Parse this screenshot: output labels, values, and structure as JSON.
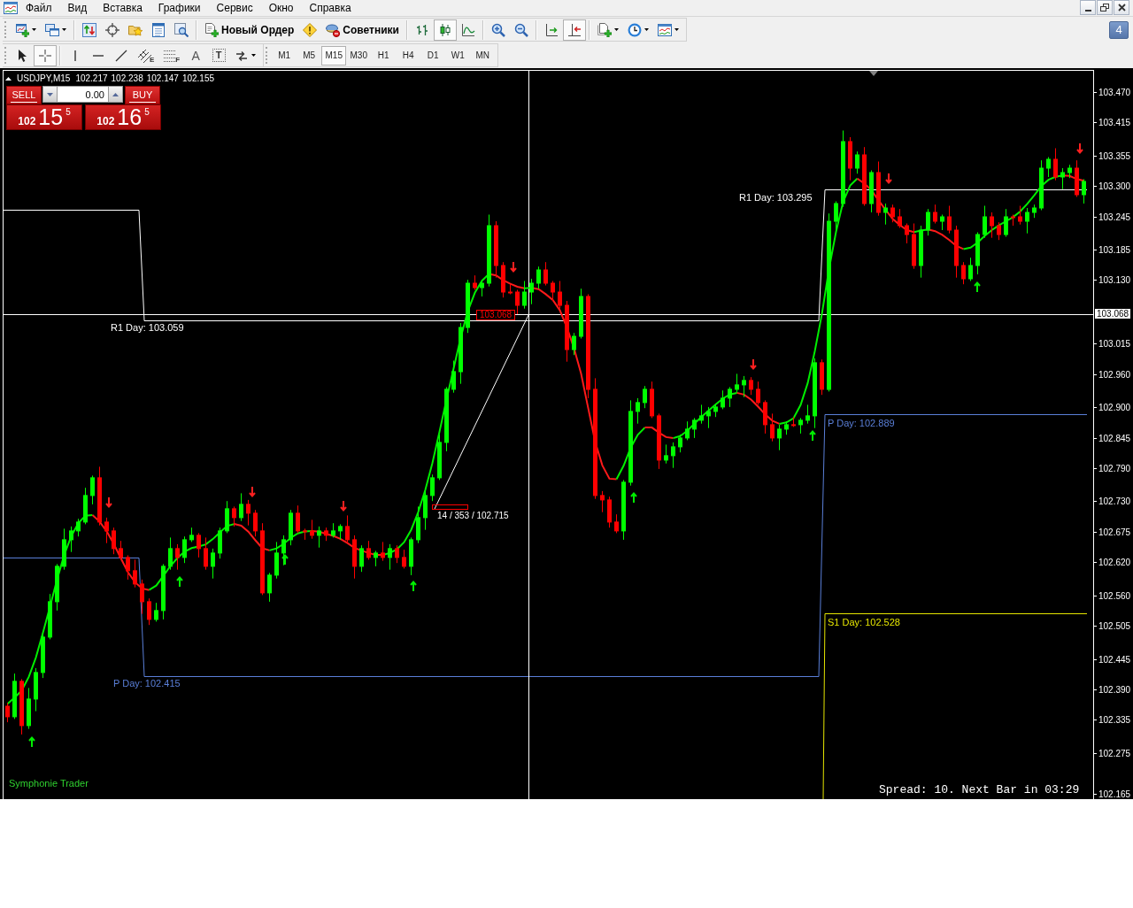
{
  "menu": {
    "items": [
      "Файл",
      "Вид",
      "Вставка",
      "Графики",
      "Сервис",
      "Окно",
      "Справка"
    ]
  },
  "toolbar": {
    "groups": [
      [
        {
          "kind": "newchart",
          "dropdown": true
        },
        {
          "kind": "profiles",
          "dropdown": true
        }
      ],
      [
        {
          "kind": "marketwatch"
        },
        {
          "kind": "navigator"
        },
        {
          "kind": "favorites"
        },
        {
          "kind": "terminal"
        },
        {
          "kind": "tester"
        }
      ],
      [
        {
          "kind": "neworder",
          "label": "Новый Ордер"
        },
        {
          "kind": "autotrading"
        },
        {
          "kind": "experts",
          "label": "Советники"
        }
      ],
      [
        {
          "kind": "bars",
          "selected": false
        },
        {
          "kind": "candles",
          "selected": true
        },
        {
          "kind": "line",
          "selected": false
        }
      ],
      [
        {
          "kind": "zoomin"
        },
        {
          "kind": "zoomout"
        }
      ],
      [
        {
          "kind": "shift",
          "selected": false
        },
        {
          "kind": "autoscroll",
          "selected": true
        }
      ],
      [
        {
          "kind": "template",
          "dropdown": true
        },
        {
          "kind": "periods",
          "dropdown": true
        },
        {
          "kind": "indicators",
          "dropdown": true
        }
      ]
    ],
    "messages": "4"
  },
  "drawing_toolbar": {
    "groups": [
      [
        {
          "kind": "cursor",
          "selected": false
        },
        {
          "kind": "crosshair",
          "selected": true
        }
      ],
      [
        {
          "kind": "vline"
        },
        {
          "kind": "hline"
        },
        {
          "kind": "trendline"
        },
        {
          "kind": "channel",
          "glyph": "E"
        },
        {
          "kind": "fibo",
          "glyph": "F"
        },
        {
          "kind": "text",
          "glyph": "A"
        },
        {
          "kind": "label",
          "glyph": "T"
        },
        {
          "kind": "arrows",
          "dropdown": true
        }
      ]
    ]
  },
  "timeframes": [
    {
      "label": "M1",
      "selected": false
    },
    {
      "label": "M5",
      "selected": false
    },
    {
      "label": "M15",
      "selected": true
    },
    {
      "label": "M30",
      "selected": false
    },
    {
      "label": "H1",
      "selected": false
    },
    {
      "label": "H4",
      "selected": false
    },
    {
      "label": "D1",
      "selected": false
    },
    {
      "label": "W1",
      "selected": false
    },
    {
      "label": "MN",
      "selected": false
    }
  ],
  "chart": {
    "symbol": "USDJPY,M15",
    "quotes": [
      "102.217",
      "102.238",
      "102.147",
      "102.155"
    ],
    "trade_panel": {
      "sell": {
        "label": "SELL",
        "handle": "102",
        "pips": "15",
        "point": "5"
      },
      "volume": "0.00",
      "buy": {
        "label": "BUY",
        "handle": "102",
        "pips": "16",
        "point": "5"
      }
    },
    "pivots": [
      {
        "color": "#ffffff",
        "labels": [
          "R1 Day: 103.059",
          "R1 Day: 103.295"
        ]
      },
      {
        "color": "#5a7fd8",
        "labels": [
          "P Day: 102.415",
          "P Day: 102.889"
        ]
      },
      {
        "color": "#e6e600",
        "labels": [
          "S1 Day: 102.528"
        ]
      }
    ],
    "price_tag": "103.068",
    "readout": "14 / 353 / 102.715",
    "indicator": "Symphonie Trader",
    "status": "Spread: 10. Next Bar in 03:29",
    "current_price": "103.068",
    "axis_bottom_label": "102.165",
    "chart_data": {
      "type": "candlestick",
      "categories": [
        null,
        null,
        null,
        null,
        null,
        null,
        null,
        null,
        null,
        null,
        null,
        null,
        null,
        null,
        null,
        null,
        null,
        null,
        null,
        null,
        null,
        null,
        null,
        null,
        null,
        null,
        null,
        null,
        null,
        null,
        null,
        null,
        null,
        null,
        null,
        null,
        null,
        null,
        null,
        null,
        null,
        null,
        null,
        null,
        null,
        null,
        null,
        null,
        null,
        null,
        null,
        null,
        null,
        null,
        null,
        null,
        null,
        null,
        null,
        null,
        null,
        null,
        null,
        null,
        null,
        null,
        null,
        null,
        null,
        null,
        null,
        null,
        null,
        null,
        null,
        null,
        null,
        null,
        null,
        null,
        null,
        null,
        null,
        null,
        null,
        null,
        null,
        null,
        null,
        null,
        null,
        null,
        null,
        null,
        null,
        null,
        null,
        null,
        null,
        null,
        null,
        null,
        null,
        null,
        null,
        null,
        null,
        null,
        null,
        null,
        null,
        null,
        null,
        null,
        null,
        null,
        null,
        null,
        null,
        null,
        null,
        null,
        null,
        null,
        null,
        null,
        null,
        null,
        null,
        null,
        null,
        null,
        null,
        null,
        null,
        null,
        null,
        null,
        null,
        null,
        null,
        null,
        null,
        null,
        null,
        null,
        null,
        null,
        null,
        null,
        null,
        null,
        null
      ],
      "ohlc": [
        [
          102.361,
          102.367,
          102.332,
          102.342
        ],
        [
          102.342,
          102.42,
          102.338,
          102.406
        ],
        [
          102.406,
          102.41,
          102.31,
          102.326
        ],
        [
          102.326,
          102.394,
          102.32,
          102.374
        ],
        [
          102.374,
          102.43,
          102.352,
          102.422
        ],
        [
          102.422,
          102.492,
          102.412,
          102.486
        ],
        [
          102.486,
          102.564,
          102.482,
          102.55
        ],
        [
          102.55,
          102.618,
          102.534,
          102.614
        ],
        [
          102.614,
          102.682,
          102.608,
          102.662
        ],
        [
          102.662,
          102.686,
          102.64,
          102.678
        ],
        [
          102.678,
          102.7,
          102.668,
          102.694
        ],
        [
          102.694,
          102.756,
          102.69,
          102.742
        ],
        [
          102.742,
          102.778,
          102.726,
          102.774
        ],
        [
          102.774,
          102.794,
          102.688,
          102.694
        ],
        [
          102.694,
          102.702,
          102.656,
          102.678
        ],
        [
          102.678,
          102.684,
          102.636,
          102.646
        ],
        [
          102.646,
          102.66,
          102.626,
          102.63
        ],
        [
          102.63,
          102.634,
          102.59,
          102.606
        ],
        [
          102.606,
          102.626,
          102.576,
          102.582
        ],
        [
          102.582,
          102.59,
          102.528,
          102.55
        ],
        [
          102.55,
          102.556,
          102.508,
          102.518
        ],
        [
          102.518,
          102.548,
          102.514,
          102.534
        ],
        [
          102.534,
          102.618,
          102.518,
          102.614
        ],
        [
          102.614,
          102.666,
          102.608,
          102.646
        ],
        [
          102.646,
          102.654,
          102.608,
          102.63
        ],
        [
          102.63,
          102.668,
          102.62,
          102.662
        ],
        [
          102.662,
          102.684,
          102.658,
          102.67
        ],
        [
          102.67,
          102.674,
          102.63,
          102.646
        ],
        [
          102.646,
          102.666,
          102.608,
          102.614
        ],
        [
          102.614,
          102.646,
          102.592,
          102.638
        ],
        [
          102.638,
          102.684,
          102.628,
          102.678
        ],
        [
          102.678,
          102.732,
          102.674,
          102.718
        ],
        [
          102.718,
          102.722,
          102.686,
          102.702
        ],
        [
          102.702,
          102.746,
          102.696,
          102.726
        ],
        [
          102.726,
          102.734,
          102.688,
          102.71
        ],
        [
          102.71,
          102.716,
          102.668,
          102.678
        ],
        [
          102.678,
          102.692,
          102.562,
          102.566
        ],
        [
          102.566,
          102.602,
          102.55,
          102.598
        ],
        [
          102.598,
          102.658,
          102.592,
          102.638
        ],
        [
          102.638,
          102.67,
          102.616,
          102.662
        ],
        [
          102.662,
          102.716,
          102.652,
          102.71
        ],
        [
          102.71,
          102.724,
          102.674,
          102.678
        ],
        [
          102.678,
          102.682,
          102.662,
          102.678
        ],
        [
          102.678,
          102.698,
          102.664,
          102.67
        ],
        [
          102.67,
          102.686,
          102.648,
          102.678
        ],
        [
          102.678,
          102.684,
          102.66,
          102.67
        ],
        [
          102.67,
          102.692,
          102.666,
          102.678
        ],
        [
          102.678,
          102.69,
          102.662,
          102.686
        ],
        [
          102.686,
          102.706,
          102.656,
          102.662
        ],
        [
          102.662,
          102.67,
          102.592,
          102.614
        ],
        [
          102.614,
          102.652,
          102.604,
          102.646
        ],
        [
          102.646,
          102.66,
          102.626,
          102.63
        ],
        [
          102.63,
          102.642,
          102.614,
          102.638
        ],
        [
          102.638,
          102.658,
          102.624,
          102.63
        ],
        [
          102.63,
          102.654,
          102.608,
          102.646
        ],
        [
          102.646,
          102.652,
          102.62,
          102.63
        ],
        [
          102.63,
          102.644,
          102.61,
          102.614
        ],
        [
          102.614,
          102.666,
          102.598,
          102.662
        ],
        [
          102.662,
          102.722,
          102.656,
          102.702
        ],
        [
          102.702,
          102.75,
          102.68,
          102.742
        ],
        [
          102.742,
          102.78,
          102.732,
          102.774
        ],
        [
          102.774,
          102.852,
          102.77,
          102.838
        ],
        [
          102.838,
          102.938,
          102.822,
          102.934
        ],
        [
          102.934,
          102.986,
          102.928,
          102.966
        ],
        [
          102.966,
          103.054,
          102.944,
          103.046
        ],
        [
          103.046,
          103.132,
          103.036,
          103.126
        ],
        [
          103.126,
          103.14,
          103.114,
          103.118
        ],
        [
          103.118,
          103.13,
          103.102,
          103.126
        ],
        [
          103.126,
          103.25,
          103.12,
          103.23
        ],
        [
          103.23,
          103.238,
          103.136,
          103.158
        ],
        [
          103.158,
          103.164,
          103.1,
          103.11
        ],
        [
          103.11,
          103.124,
          103.106,
          103.11
        ],
        [
          103.11,
          103.114,
          103.07,
          103.086
        ],
        [
          103.086,
          103.13,
          103.08,
          103.11
        ],
        [
          103.11,
          103.134,
          103.088,
          103.126
        ],
        [
          103.126,
          103.156,
          103.116,
          103.15
        ],
        [
          103.15,
          103.164,
          103.122,
          103.126
        ],
        [
          103.126,
          103.13,
          103.094,
          103.11
        ],
        [
          103.11,
          103.13,
          103.08,
          103.086
        ],
        [
          103.086,
          103.094,
          102.984,
          103.006
        ],
        [
          103.006,
          103.036,
          102.996,
          103.03
        ],
        [
          103.03,
          103.116,
          103.026,
          103.102
        ],
        [
          103.102,
          103.106,
          102.918,
          102.934
        ],
        [
          102.934,
          102.954,
          102.736,
          102.742
        ],
        [
          102.742,
          102.75,
          102.712,
          102.734
        ],
        [
          102.734,
          102.74,
          102.684,
          102.694
        ],
        [
          102.694,
          102.708,
          102.674,
          102.678
        ],
        [
          102.678,
          102.77,
          102.662,
          102.766
        ],
        [
          102.766,
          102.914,
          102.76,
          102.894
        ],
        [
          102.894,
          102.918,
          102.872,
          102.91
        ],
        [
          102.91,
          102.94,
          102.9,
          102.934
        ],
        [
          102.934,
          102.948,
          102.882,
          102.886
        ],
        [
          102.886,
          102.89,
          102.79,
          102.806
        ],
        [
          102.806,
          102.834,
          102.8,
          102.814
        ],
        [
          102.814,
          102.838,
          102.792,
          102.83
        ],
        [
          102.83,
          102.852,
          102.82,
          102.846
        ],
        [
          102.846,
          102.876,
          102.842,
          102.862
        ],
        [
          102.862,
          102.882,
          102.846,
          102.878
        ],
        [
          102.878,
          102.906,
          102.872,
          102.886
        ],
        [
          102.886,
          102.902,
          102.864,
          102.894
        ],
        [
          102.894,
          102.908,
          102.884,
          102.902
        ],
        [
          102.902,
          102.932,
          102.898,
          102.918
        ],
        [
          102.918,
          102.938,
          102.902,
          102.934
        ],
        [
          102.934,
          102.962,
          102.928,
          102.942
        ],
        [
          102.942,
          102.958,
          102.92,
          102.95
        ],
        [
          102.95,
          102.956,
          102.924,
          102.934
        ],
        [
          102.934,
          102.948,
          102.906,
          102.91
        ],
        [
          102.91,
          102.914,
          102.854,
          102.87
        ],
        [
          102.87,
          102.89,
          102.84,
          102.846
        ],
        [
          102.846,
          102.87,
          102.824,
          102.862
        ],
        [
          102.862,
          102.876,
          102.852,
          102.87
        ],
        [
          102.87,
          102.884,
          102.866,
          102.87
        ],
        [
          102.87,
          102.882,
          102.854,
          102.878
        ],
        [
          102.878,
          102.906,
          102.872,
          102.886
        ],
        [
          102.886,
          102.99,
          102.864,
          102.982
        ],
        [
          102.982,
          102.988,
          102.924,
          102.934
        ],
        [
          102.934,
          103.252,
          102.93,
          103.238
        ],
        [
          103.238,
          103.274,
          103.222,
          103.27
        ],
        [
          103.27,
          103.402,
          103.264,
          103.382
        ],
        [
          103.382,
          103.39,
          103.312,
          103.334
        ],
        [
          103.334,
          103.364,
          103.324,
          103.358
        ],
        [
          103.358,
          103.372,
          103.266,
          103.27
        ],
        [
          103.27,
          103.33,
          103.254,
          103.326
        ],
        [
          103.326,
          103.346,
          103.248,
          103.254
        ],
        [
          103.254,
          103.27,
          103.232,
          103.262
        ],
        [
          103.262,
          103.268,
          103.236,
          103.246
        ],
        [
          103.246,
          103.26,
          103.226,
          103.23
        ],
        [
          103.23,
          103.234,
          103.198,
          103.214
        ],
        [
          103.214,
          103.234,
          103.152,
          103.158
        ],
        [
          103.158,
          103.23,
          103.136,
          103.222
        ],
        [
          103.222,
          103.26,
          103.212,
          103.254
        ],
        [
          103.254,
          103.268,
          103.234,
          103.238
        ],
        [
          103.238,
          103.25,
          103.222,
          103.246
        ],
        [
          103.246,
          103.266,
          103.216,
          103.222
        ],
        [
          103.222,
          103.23,
          103.136,
          103.158
        ],
        [
          103.158,
          103.164,
          103.124,
          103.134
        ],
        [
          103.134,
          103.172,
          103.13,
          103.158
        ],
        [
          103.158,
          103.218,
          103.142,
          103.214
        ],
        [
          103.214,
          103.266,
          103.208,
          103.246
        ],
        [
          103.246,
          103.254,
          103.208,
          103.23
        ],
        [
          103.23,
          103.236,
          103.204,
          103.214
        ],
        [
          103.214,
          103.26,
          103.21,
          103.246
        ],
        [
          103.246,
          103.25,
          103.23,
          103.246
        ],
        [
          103.246,
          103.266,
          103.232,
          103.238
        ],
        [
          103.238,
          103.262,
          103.216,
          103.254
        ],
        [
          103.254,
          103.268,
          103.244,
          103.262
        ],
        [
          103.262,
          103.348,
          103.258,
          103.334
        ],
        [
          103.334,
          103.354,
          103.318,
          103.35
        ],
        [
          103.35,
          103.37,
          103.312,
          103.318
        ],
        [
          103.318,
          103.334,
          103.296,
          103.326
        ],
        [
          103.326,
          103.34,
          103.316,
          103.334
        ],
        [
          103.334,
          103.348,
          103.282,
          103.286
        ],
        [
          103.286,
          103.314,
          103.27,
          103.31
        ]
      ],
      "ylim": [
        102.193,
        103.51
      ],
      "yticks": [
        {
          "value": 103.47,
          "label": "103.470"
        },
        {
          "value": 103.415,
          "label": "103.415"
        },
        {
          "value": 103.355,
          "label": "103.355"
        },
        {
          "value": 103.3,
          "label": "103.300"
        },
        {
          "value": 103.245,
          "label": "103.245"
        },
        {
          "value": 103.185,
          "label": "103.185"
        },
        {
          "value": 103.13,
          "label": "103.130"
        },
        {
          "value": 103.015,
          "label": "103.015"
        },
        {
          "value": 102.96,
          "label": "102.960"
        },
        {
          "value": 102.9,
          "label": "102.900"
        },
        {
          "value": 102.845,
          "label": "102.845"
        },
        {
          "value": 102.79,
          "label": "102.790"
        },
        {
          "value": 102.73,
          "label": "102.730"
        },
        {
          "value": 102.675,
          "label": "102.675"
        },
        {
          "value": 102.62,
          "label": "102.620"
        },
        {
          "value": 102.56,
          "label": "102.560"
        },
        {
          "value": 102.505,
          "label": "102.505"
        },
        {
          "value": 102.445,
          "label": "102.445"
        },
        {
          "value": 102.39,
          "label": "102.390"
        },
        {
          "value": 102.335,
          "label": "102.335"
        },
        {
          "value": 102.275,
          "label": "102.275"
        }
      ]
    }
  }
}
